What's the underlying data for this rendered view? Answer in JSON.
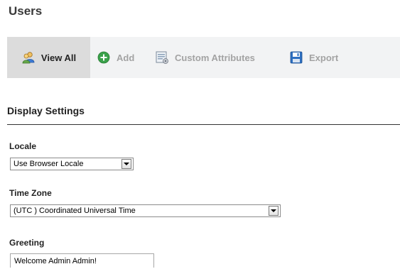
{
  "page": {
    "title": "Users"
  },
  "toolbar": {
    "view_all": "View All",
    "add": "Add",
    "custom_attributes": "Custom Attributes",
    "export": "Export"
  },
  "display_settings": {
    "title": "Display Settings",
    "locale": {
      "label": "Locale",
      "value": "Use Browser Locale"
    },
    "time_zone": {
      "label": "Time Zone",
      "value": "(UTC ) Coordinated Universal Time"
    },
    "greeting": {
      "label": "Greeting",
      "value": "Welcome Admin Admin!"
    }
  },
  "colors": {
    "toolbar_bg": "#f2f3f4",
    "active_tab_bg": "#dcdcdc",
    "add_icon": "#3aa14a",
    "disabled_text": "#a3a3a3"
  },
  "icons": {
    "view_all": "users-icon",
    "add": "plus-circle-icon",
    "custom_attributes": "attributes-icon",
    "export": "save-icon"
  }
}
